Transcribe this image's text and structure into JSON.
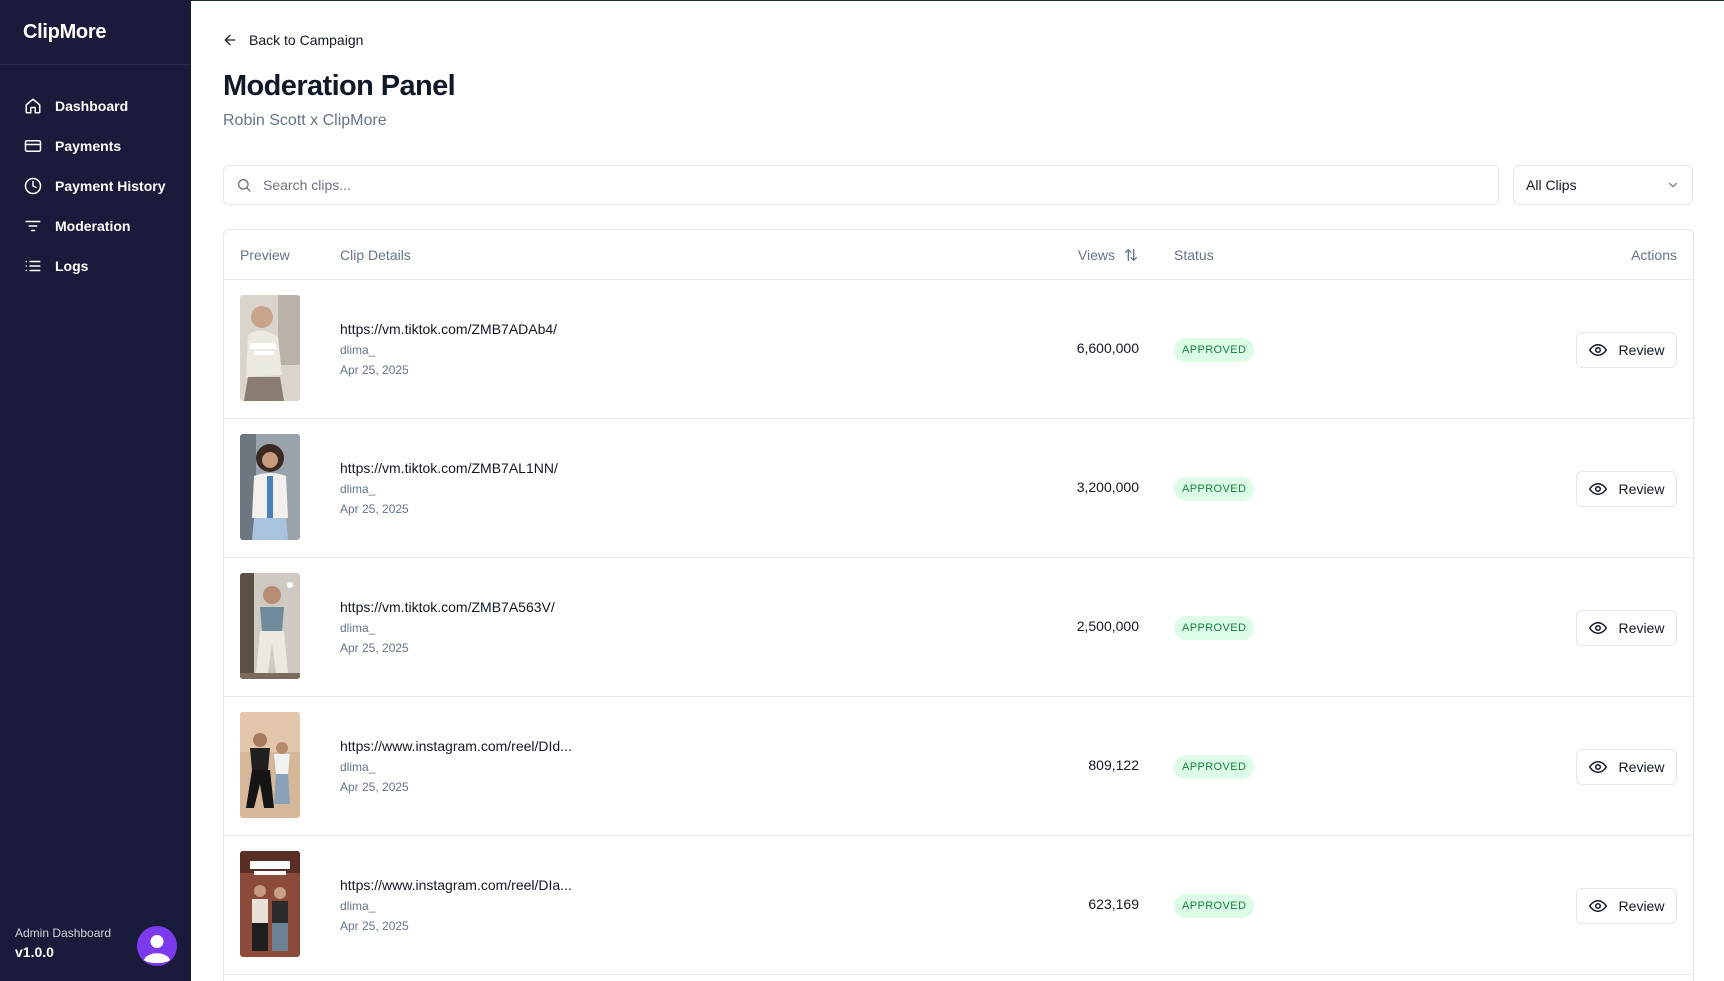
{
  "sidebar": {
    "brand": "ClipMore",
    "items": [
      {
        "label": "Dashboard",
        "icon": "home-icon"
      },
      {
        "label": "Payments",
        "icon": "credit-card-icon"
      },
      {
        "label": "Payment History",
        "icon": "clock-icon"
      },
      {
        "label": "Moderation",
        "icon": "filter-icon"
      },
      {
        "label": "Logs",
        "icon": "list-icon"
      }
    ],
    "footer": {
      "label": "Admin Dashboard",
      "version": "v1.0.0",
      "avatar_icon": "user-avatar-icon"
    }
  },
  "header": {
    "back_label": "Back to Campaign",
    "title": "Moderation Panel",
    "subtitle": "Robin Scott x ClipMore"
  },
  "search": {
    "placeholder": "Search clips...",
    "value": ""
  },
  "filter": {
    "value": "All Clips"
  },
  "table": {
    "columns": {
      "preview": "Preview",
      "details": "Clip Details",
      "views": "Views",
      "status": "Status",
      "actions": "Actions"
    },
    "rows": [
      {
        "url": "https://vm.tiktok.com/ZMB7ADAb4/",
        "user": "dlima_",
        "date": "Apr 25, 2025",
        "views": "6,600,000",
        "status": "APPROVED",
        "action": "Review"
      },
      {
        "url": "https://vm.tiktok.com/ZMB7AL1NN/",
        "user": "dlima_",
        "date": "Apr 25, 2025",
        "views": "3,200,000",
        "status": "APPROVED",
        "action": "Review"
      },
      {
        "url": "https://vm.tiktok.com/ZMB7A563V/",
        "user": "dlima_",
        "date": "Apr 25, 2025",
        "views": "2,500,000",
        "status": "APPROVED",
        "action": "Review"
      },
      {
        "url": "https://www.instagram.com/reel/DId...",
        "user": "dlima_",
        "date": "Apr 25, 2025",
        "views": "809,122",
        "status": "APPROVED",
        "action": "Review"
      },
      {
        "url": "https://www.instagram.com/reel/DIa...",
        "user": "dlima_",
        "date": "Apr 25, 2025",
        "views": "623,169",
        "status": "APPROVED",
        "action": "Review"
      }
    ]
  },
  "colors": {
    "sidebar_bg": "#1a1a3a",
    "badge_bg": "#dcfce7",
    "badge_text": "#15803d",
    "avatar": "#7c3aed"
  }
}
